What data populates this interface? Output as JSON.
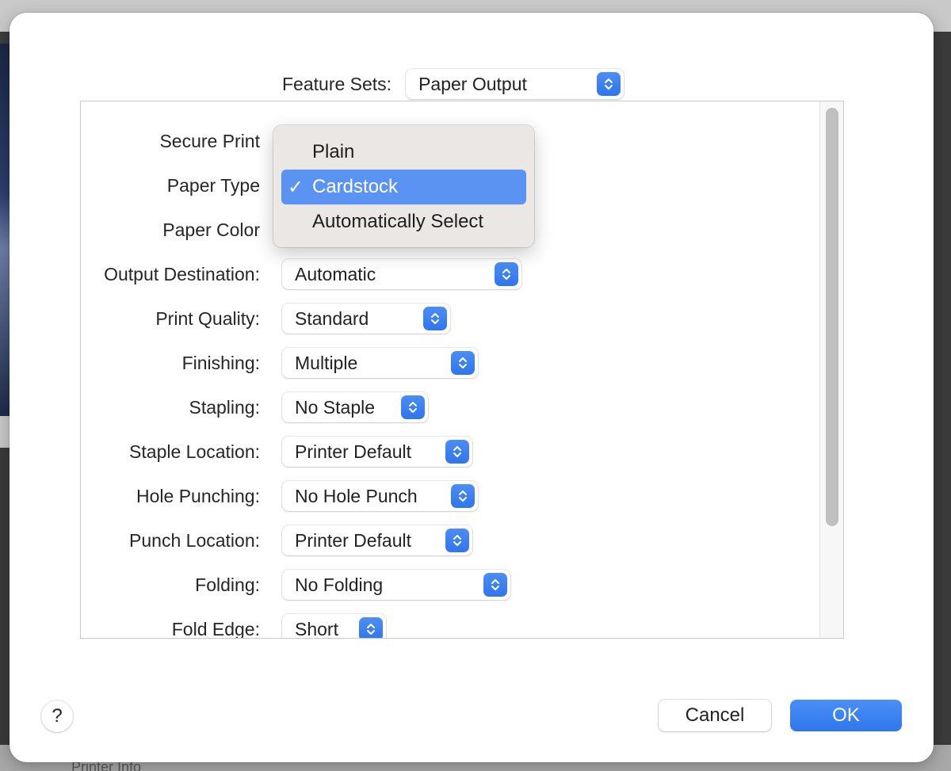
{
  "background": {
    "bottom_partial_text": "Printer Info"
  },
  "dialog": {
    "feature_sets": {
      "label": "Feature Sets:",
      "value": "Paper Output"
    },
    "settings": [
      {
        "label": "Secure Print",
        "value": ""
      },
      {
        "label": "Paper Type",
        "value": "Cardstock"
      },
      {
        "label": "Paper Color",
        "value": ""
      },
      {
        "label": "Output Destination:",
        "value": "Automatic"
      },
      {
        "label": "Print Quality:",
        "value": "Standard"
      },
      {
        "label": "Finishing:",
        "value": "Multiple"
      },
      {
        "label": "Stapling:",
        "value": "No Staple"
      },
      {
        "label": "Staple Location:",
        "value": "Printer Default"
      },
      {
        "label": "Hole Punching:",
        "value": "No Hole Punch"
      },
      {
        "label": "Punch Location:",
        "value": "Printer Default"
      },
      {
        "label": "Folding:",
        "value": "No Folding"
      },
      {
        "label": "Fold Edge:",
        "value": "Short"
      }
    ],
    "open_menu": {
      "for": "Paper Type",
      "items": [
        {
          "label": "Plain",
          "selected": false
        },
        {
          "label": "Cardstock",
          "selected": true
        },
        {
          "label": "Automatically Select",
          "selected": false
        }
      ],
      "check_glyph": "✓"
    },
    "buttons": {
      "help": "?",
      "cancel": "Cancel",
      "ok": "OK"
    },
    "colors": {
      "accent": "#2f77ee",
      "menu_highlight": "#5b93f3"
    }
  }
}
